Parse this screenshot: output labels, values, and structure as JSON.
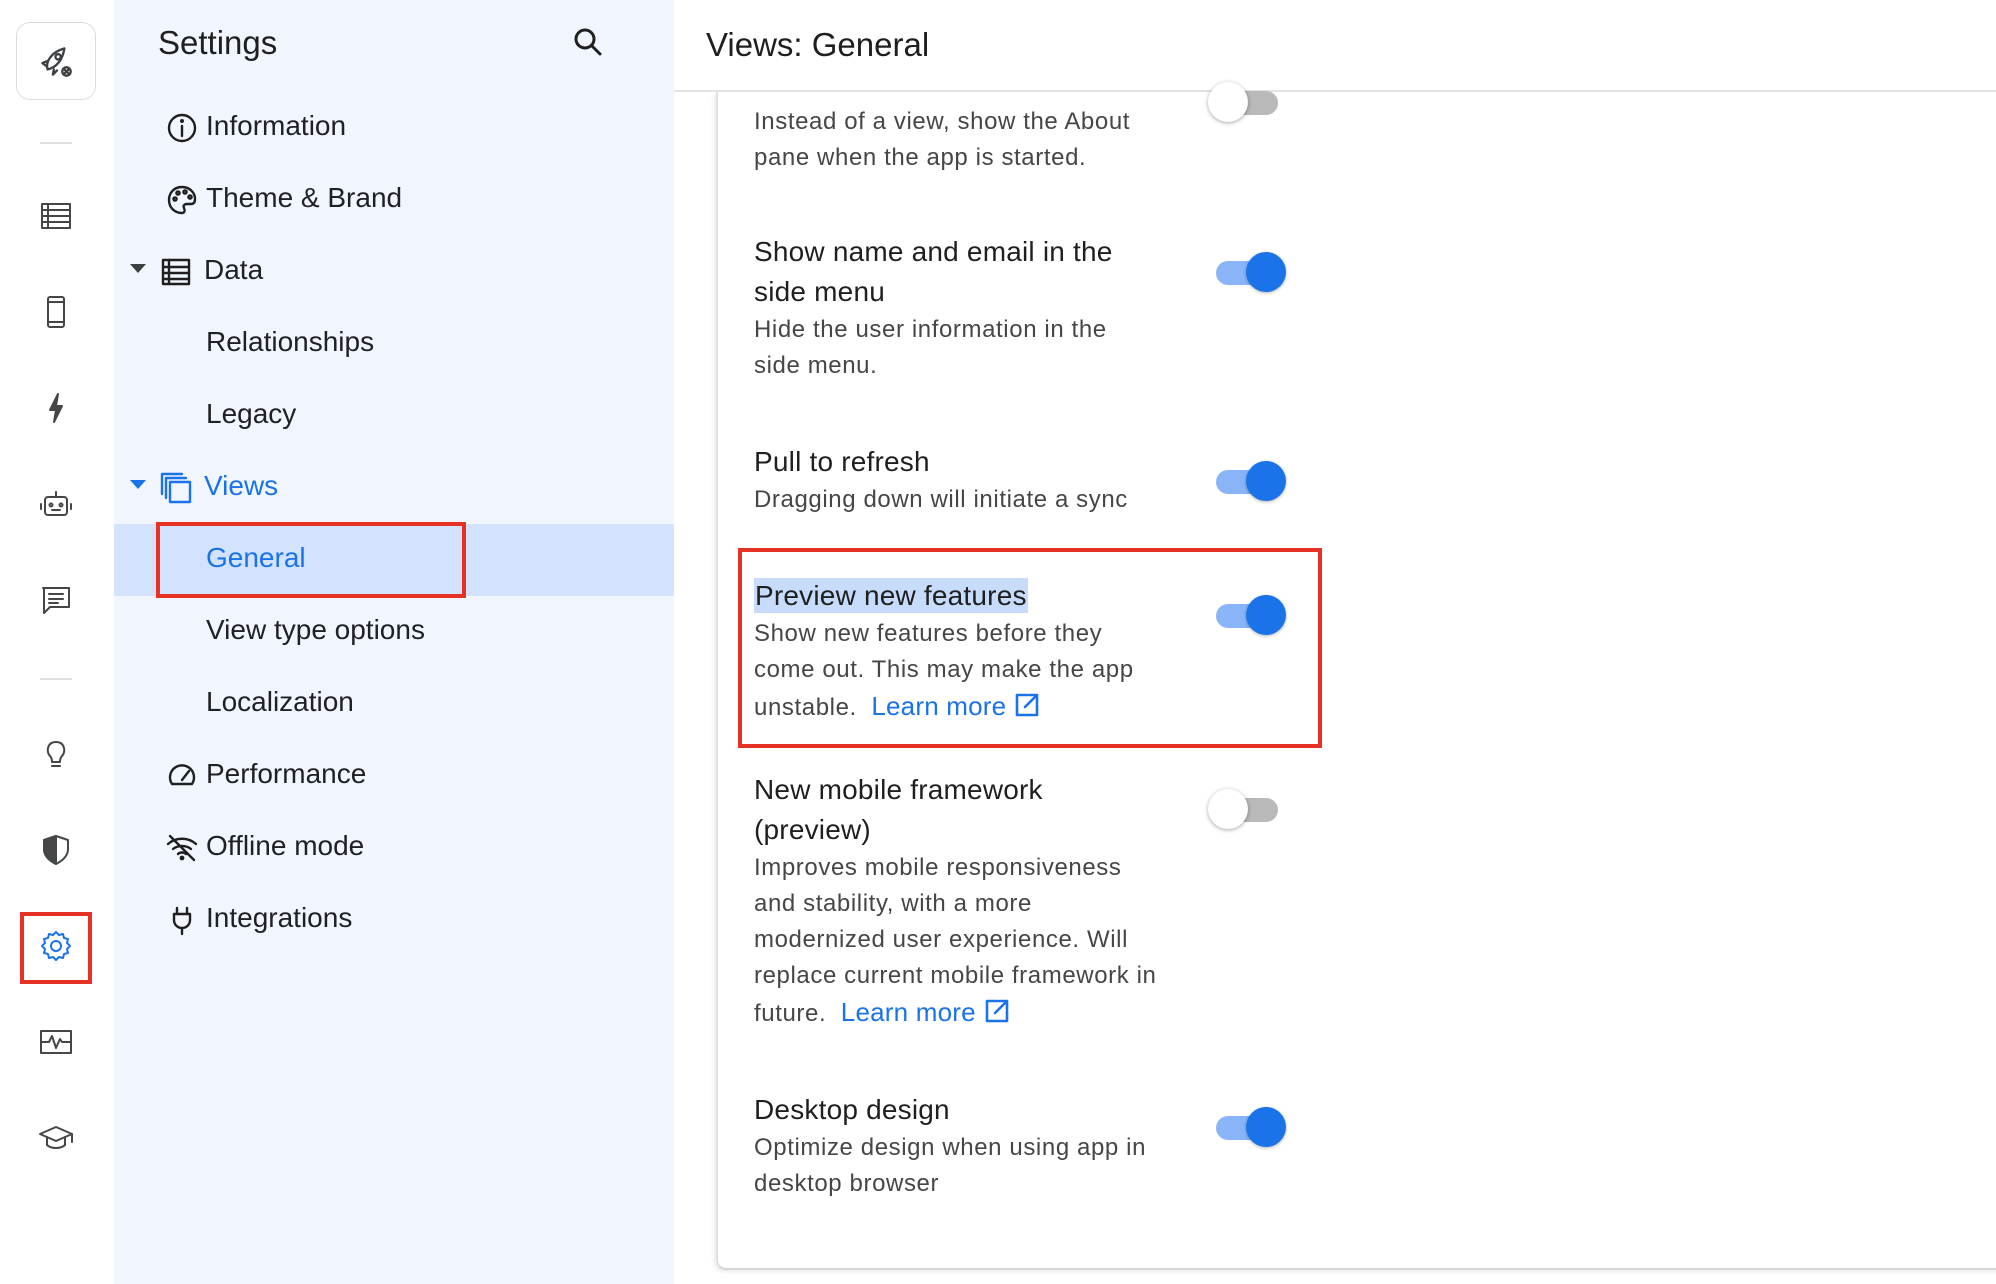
{
  "rail": {
    "items": [
      {
        "name": "rail-tables-icon"
      },
      {
        "name": "rail-mobile-icon"
      },
      {
        "name": "rail-bolt-icon"
      },
      {
        "name": "rail-bot-icon"
      },
      {
        "name": "rail-chat-icon"
      },
      {
        "name": "rail-bulb-icon"
      },
      {
        "name": "rail-shield-icon"
      },
      {
        "name": "rail-settings-icon",
        "active": true
      },
      {
        "name": "rail-monitor-icon"
      },
      {
        "name": "rail-learn-icon"
      }
    ]
  },
  "sidebar": {
    "title": "Settings",
    "items": [
      {
        "label": "Information",
        "icon": "info-icon"
      },
      {
        "label": "Theme & Brand",
        "icon": "palette-icon"
      },
      {
        "label": "Data",
        "icon": "table-icon",
        "expanded": true
      },
      {
        "label": "Relationships"
      },
      {
        "label": "Legacy"
      },
      {
        "label": "Views",
        "icon": "views-icon",
        "expanded": true
      },
      {
        "label": "General",
        "selected": true
      },
      {
        "label": "View type options"
      },
      {
        "label": "Localization"
      },
      {
        "label": "Performance",
        "icon": "gauge-icon"
      },
      {
        "label": "Offline mode",
        "icon": "wifi-off-icon"
      },
      {
        "label": "Integrations",
        "icon": "plug-icon"
      }
    ]
  },
  "main": {
    "title": "Views: General",
    "settings": [
      {
        "title": "",
        "desc": "Instead of a view, show the About pane when the app is started.",
        "on": false
      },
      {
        "title": "Show name and email in the side menu",
        "desc": "Hide the user information in the side menu.",
        "on": true
      },
      {
        "title": "Pull to refresh",
        "desc": "Dragging down will initiate a sync",
        "on": true
      },
      {
        "title": "Preview new features",
        "desc": "Show new features before they come out. This may make the app unstable.",
        "link": "Learn more",
        "on": true
      },
      {
        "title": "New mobile framework (preview)",
        "desc": "Improves mobile responsiveness and stability, with a more modernized user experience. Will replace current mobile framework in future.",
        "link": "Learn more",
        "on": false
      },
      {
        "title": "Desktop design",
        "desc": "Optimize design when using app in desktop browser",
        "on": true
      }
    ]
  },
  "colors": {
    "accent": "#1a73e8",
    "highlight_box": "#e53224",
    "sidebar_bg": "#f1f5fd",
    "selected_bg": "#d3e3fd"
  }
}
